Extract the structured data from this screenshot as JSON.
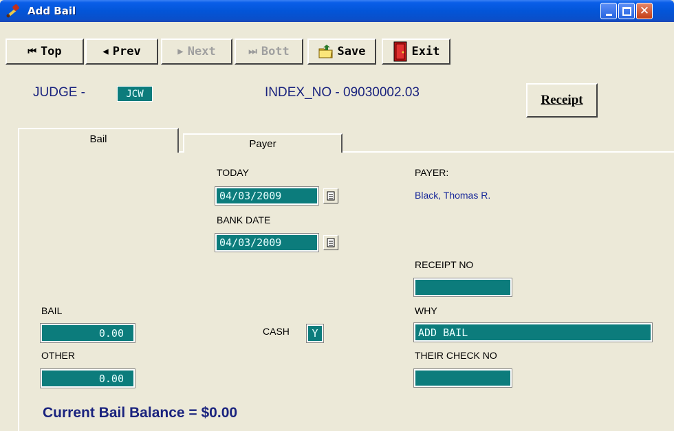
{
  "window": {
    "title": "Add Bail"
  },
  "toolbar": {
    "top": "Top",
    "prev": "Prev",
    "next": "Next",
    "bott": "Bott",
    "save": "Save",
    "exit": "Exit"
  },
  "header": {
    "judge_label": "JUDGE -",
    "judge_value": "JCW",
    "index_label": "INDEX_NO - 09030002.03",
    "receipt_button": "Receipt"
  },
  "tabs": [
    {
      "label": "Bail",
      "active": true
    },
    {
      "label": "Payer",
      "active": false
    }
  ],
  "form": {
    "today_label": "TODAY",
    "today_value": "04/03/2009",
    "bank_date_label": "BANK DATE",
    "bank_date_value": "04/03/2009",
    "payer_label": "PAYER:",
    "payer_value": "Black, Thomas R.",
    "receipt_no_label": "RECEIPT NO",
    "receipt_no_value": "",
    "bail_label": "BAIL",
    "bail_value": "0.00",
    "cash_label": "CASH",
    "cash_value": "Y",
    "why_label": "WHY",
    "why_value": "ADD BAIL",
    "other_label": "OTHER",
    "other_value": "0.00",
    "their_check_label": "THEIR CHECK NO",
    "their_check_value": "",
    "balance_text": "Current Bail Balance = $0.00"
  },
  "colors": {
    "field_bg": "#0c7c7c",
    "header_text": "#1a237e",
    "window_bg": "#ece9d8",
    "titlebar": "#0355d8"
  }
}
